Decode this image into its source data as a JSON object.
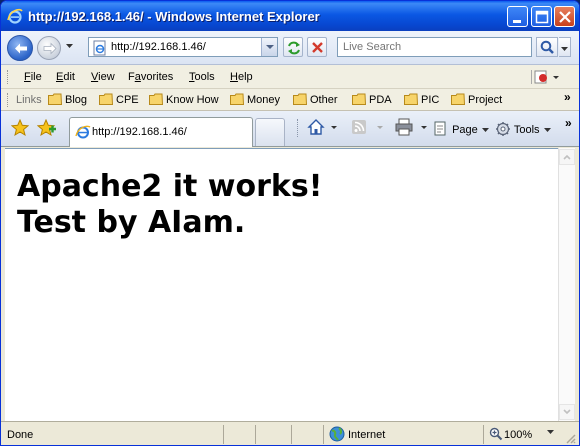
{
  "window": {
    "title": "http://192.168.1.46/ - Windows Internet Explorer"
  },
  "address_bar": {
    "url": "http://192.168.1.46/"
  },
  "search": {
    "placeholder": "Live Search"
  },
  "menu": {
    "items": [
      {
        "label": "File",
        "mnemonic": "F",
        "rest": "ile"
      },
      {
        "label": "Edit",
        "mnemonic": "E",
        "rest": "dit"
      },
      {
        "label": "View",
        "mnemonic": "V",
        "rest": "iew"
      },
      {
        "label": "Favorites",
        "mnemonic": "a",
        "prefix": "F",
        "rest": "vorites"
      },
      {
        "label": "Tools",
        "mnemonic": "T",
        "rest": "ools"
      },
      {
        "label": "Help",
        "mnemonic": "H",
        "rest": "elp"
      }
    ]
  },
  "links_bar": {
    "label": "Links",
    "items": [
      "Blog",
      "CPE",
      "Know How",
      "Money",
      "Other",
      "PDA",
      "PIC",
      "Project"
    ],
    "overflow": "»"
  },
  "tabs": {
    "active": "http://192.168.1.46/"
  },
  "command_bar": {
    "page_label": "Page",
    "tools_label": "Tools",
    "overflow": "»"
  },
  "content": {
    "line1": "Apache2 it works!",
    "line2": "Test by AIam."
  },
  "status": {
    "text": "Done",
    "zone": "Internet",
    "zoom": "100%"
  }
}
